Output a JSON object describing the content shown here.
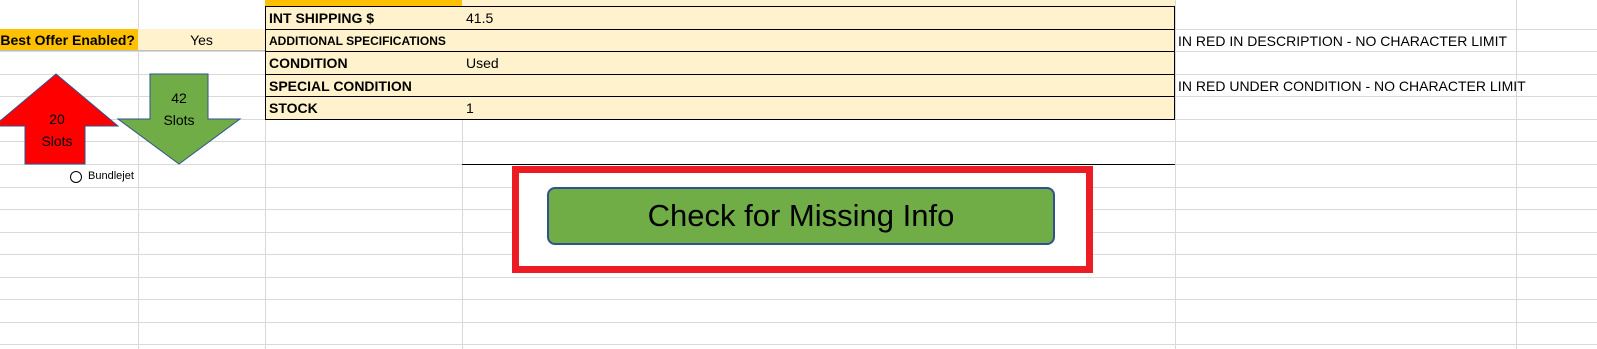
{
  "sheet": {
    "best_offer_label": "Best Offer Enabled?",
    "best_offer_value": "Yes",
    "rows": [
      {
        "label": "INT SHIPPING $",
        "value": "41.5",
        "note": ""
      },
      {
        "label": "ADDITIONAL SPECIFICATIONS",
        "value": "",
        "note": "IN RED IN DESCRIPTION - NO CHARACTER LIMIT"
      },
      {
        "label": "CONDITION",
        "value": "Used",
        "note": ""
      },
      {
        "label": "SPECIAL CONDITION",
        "value": "",
        "note": "IN RED UNDER CONDITION - NO CHARACTER LIMIT"
      },
      {
        "label": "STOCK",
        "value": "1",
        "note": ""
      }
    ]
  },
  "arrows": {
    "up": {
      "count": "20",
      "unit": "Slots",
      "color": "#ff0000"
    },
    "down": {
      "count": "42",
      "unit": "Slots",
      "color": "#70ad47"
    }
  },
  "radio": {
    "label": "Bundlejet"
  },
  "check_button": {
    "label": "Check for Missing Info"
  },
  "colors": {
    "accent": "#ffc000",
    "cell_fill": "#fff2cc",
    "frame": "#ed1c24",
    "button": "#70ad47"
  }
}
